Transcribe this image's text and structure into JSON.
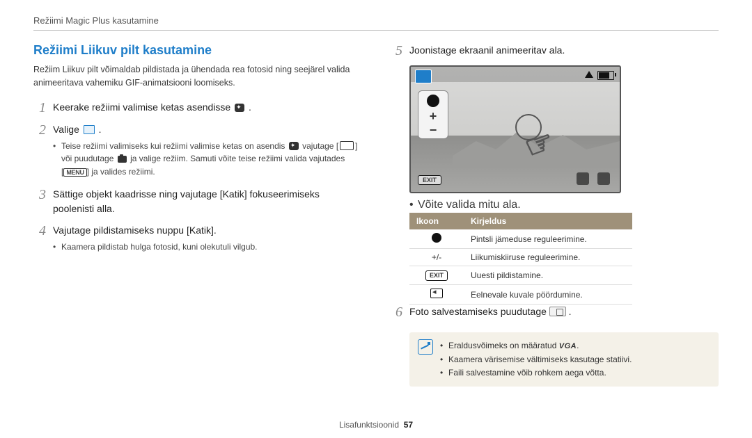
{
  "header": {
    "breadcrumb": "Režiimi Magic Plus kasutamine"
  },
  "left": {
    "title": "Režiimi Liikuv pilt kasutamine",
    "intro": "Režiim Liikuv pilt võimaldab pildistada ja ühendada rea fotosid ning seejärel valida animeeritava vahemiku GIF-animatsiooni loomiseks.",
    "step1_num": "1",
    "step1_a": "Keerake režiimi valimise ketas asendisse ",
    "step1_b": ".",
    "step2_num": "2",
    "step2_a": "Valige ",
    "step2_b": ".",
    "step2_sub_a": "Teise režiimi valimiseks kui režiimi valimise ketas on asendis ",
    "step2_sub_b": " vajutage ",
    "step2_sub_c": " või puudutage ",
    "step2_sub_d": " ja valige režiim. Samuti võite teise režiimi valida vajutades ",
    "step2_sub_e": " ja valides režiimi.",
    "menu_label": "MENU",
    "step3_num": "3",
    "step3": "Sättige objekt kaadrisse ning vajutage [Katik] fokuseerimiseks poolenisti alla.",
    "step4_num": "4",
    "step4": "Vajutage pildistamiseks nuppu [Katik].",
    "step4_sub": "Kaamera pildistab hulga fotosid, kuni olekutuli vilgub."
  },
  "right": {
    "step5_num": "5",
    "step5": "Joonistage ekraanil animeeritav ala.",
    "shot": {
      "exit": "EXIT"
    },
    "caption": "Võite valida mitu ala.",
    "table": {
      "h1": "Ikoon",
      "h2": "Kirjeldus",
      "r1_val": "",
      "r1_desc": "Pintsli jämeduse reguleerimine.",
      "r2_val": "+/-",
      "r2_desc": "Liikumiskiiruse reguleerimine.",
      "r3_val": "EXIT",
      "r3_desc": "Uuesti pildistamine.",
      "r4_val": "",
      "r4_desc": "Eelnevale kuvale pöördumine."
    },
    "step6_num": "6",
    "step6_a": "Foto salvestamiseks puudutage ",
    "step6_b": ".",
    "note1_a": "Eraldusvõimeks on määratud ",
    "note1_b": ".",
    "vga": "VGA",
    "note2": "Kaamera värisemise vältimiseks kasutage statiivi.",
    "note3": "Faili salvestamine võib rohkem aega võtta."
  },
  "footer": {
    "section": "Lisafunktsioonid",
    "page": "57"
  }
}
